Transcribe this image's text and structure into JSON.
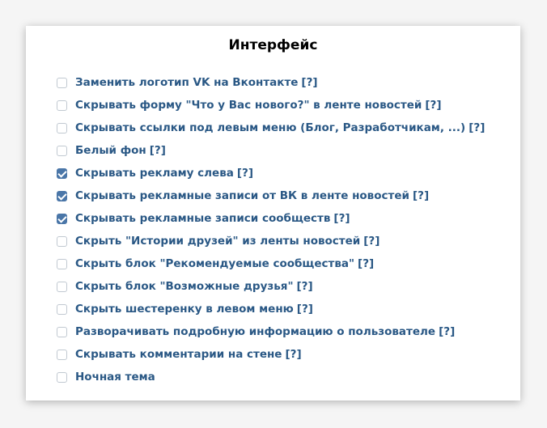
{
  "panel": {
    "title": "Интерфейс"
  },
  "options": [
    {
      "label": "Заменить логотип VK на Вконтакте",
      "help": "[?]",
      "checked": false
    },
    {
      "label": "Скрывать форму \"Что у Вас нового?\" в ленте новостей",
      "help": "[?]",
      "checked": false
    },
    {
      "label": "Скрывать ссылки под левым меню (Блог, Разработчикам, ...)",
      "help": "[?]",
      "checked": false
    },
    {
      "label": "Белый фон",
      "help": "[?]",
      "checked": false
    },
    {
      "label": "Скрывать рекламу слева",
      "help": "[?]",
      "checked": true
    },
    {
      "label": "Скрывать рекламные записи от ВК в ленте новостей",
      "help": "[?]",
      "checked": true
    },
    {
      "label": "Скрывать рекламные записи сообществ",
      "help": "[?]",
      "checked": true
    },
    {
      "label": "Скрыть \"Истории друзей\" из ленты новостей",
      "help": "[?]",
      "checked": false
    },
    {
      "label": "Скрыть блок \"Рекомендуемые сообщества\"",
      "help": "[?]",
      "checked": false
    },
    {
      "label": "Скрыть блок \"Возможные друзья\"",
      "help": "[?]",
      "checked": false
    },
    {
      "label": "Скрыть шестеренку в левом меню",
      "help": "[?]",
      "checked": false
    },
    {
      "label": "Разворачивать подробную информацию о пользователе",
      "help": "[?]",
      "checked": false
    },
    {
      "label": "Скрывать комментарии на стене",
      "help": "[?]",
      "checked": false
    },
    {
      "label": "Ночная тема",
      "help": "",
      "checked": false
    }
  ],
  "colors": {
    "checked_fill": "#4a76a8",
    "label_text": "#2a5885",
    "unchecked_border": "#c1c9d1"
  }
}
